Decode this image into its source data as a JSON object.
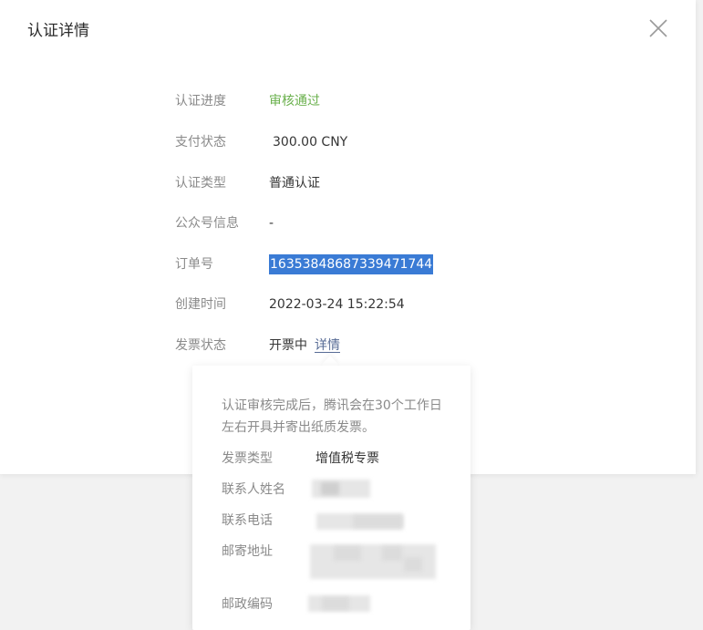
{
  "dialog": {
    "title": "认证详情",
    "close_icon": "close-icon"
  },
  "details": [
    {
      "label": "认证进度",
      "value": "审核通过",
      "status_color": "#6ab04c"
    },
    {
      "label": "支付状态",
      "value": "300.00 CNY"
    },
    {
      "label": "认证类型",
      "value": "普通认证"
    },
    {
      "label": "公众号信息",
      "value": "-"
    },
    {
      "label": "订单号",
      "value": "16353848687339471744",
      "selected": true
    },
    {
      "label": "创建时间",
      "value": "2022-03-24 15:22:54"
    },
    {
      "label": "发票状态",
      "value": "开票中",
      "link": "详情"
    }
  ],
  "invoice_popover": {
    "notice": "认证审核完成后，腾讯会在30个工作日左右开具并寄出纸质发票。",
    "rows": [
      {
        "label": "发票类型",
        "value": "增值税专票"
      },
      {
        "label": "联系人姓名",
        "value": ""
      },
      {
        "label": "联系电话",
        "value": ""
      },
      {
        "label": "邮寄地址",
        "value": ""
      },
      {
        "label": "邮政编码",
        "value": ""
      }
    ]
  },
  "colors": {
    "link": "#576b95",
    "selection": "#3a7bd5",
    "label": "#8a8a8a"
  }
}
